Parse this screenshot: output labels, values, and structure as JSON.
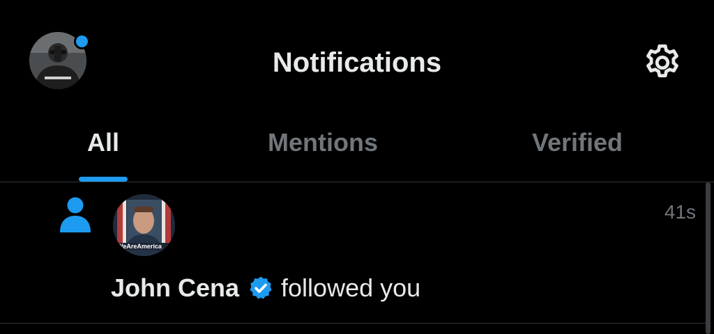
{
  "header": {
    "title": "Notifications",
    "avatar_icon": "user-avatar-photo",
    "settings_icon": "gear-icon",
    "has_unread_dot": true,
    "accent_color": "#1d9bf0"
  },
  "tabs": [
    {
      "label": "All",
      "active": true
    },
    {
      "label": "Mentions",
      "active": false
    },
    {
      "label": "Verified",
      "active": false
    }
  ],
  "notifications": [
    {
      "type_icon": "person-icon",
      "actor_name": "John Cena",
      "verified": true,
      "action": "followed you",
      "time": "41s",
      "avatar_caption": "WeAreAmerica"
    }
  ]
}
